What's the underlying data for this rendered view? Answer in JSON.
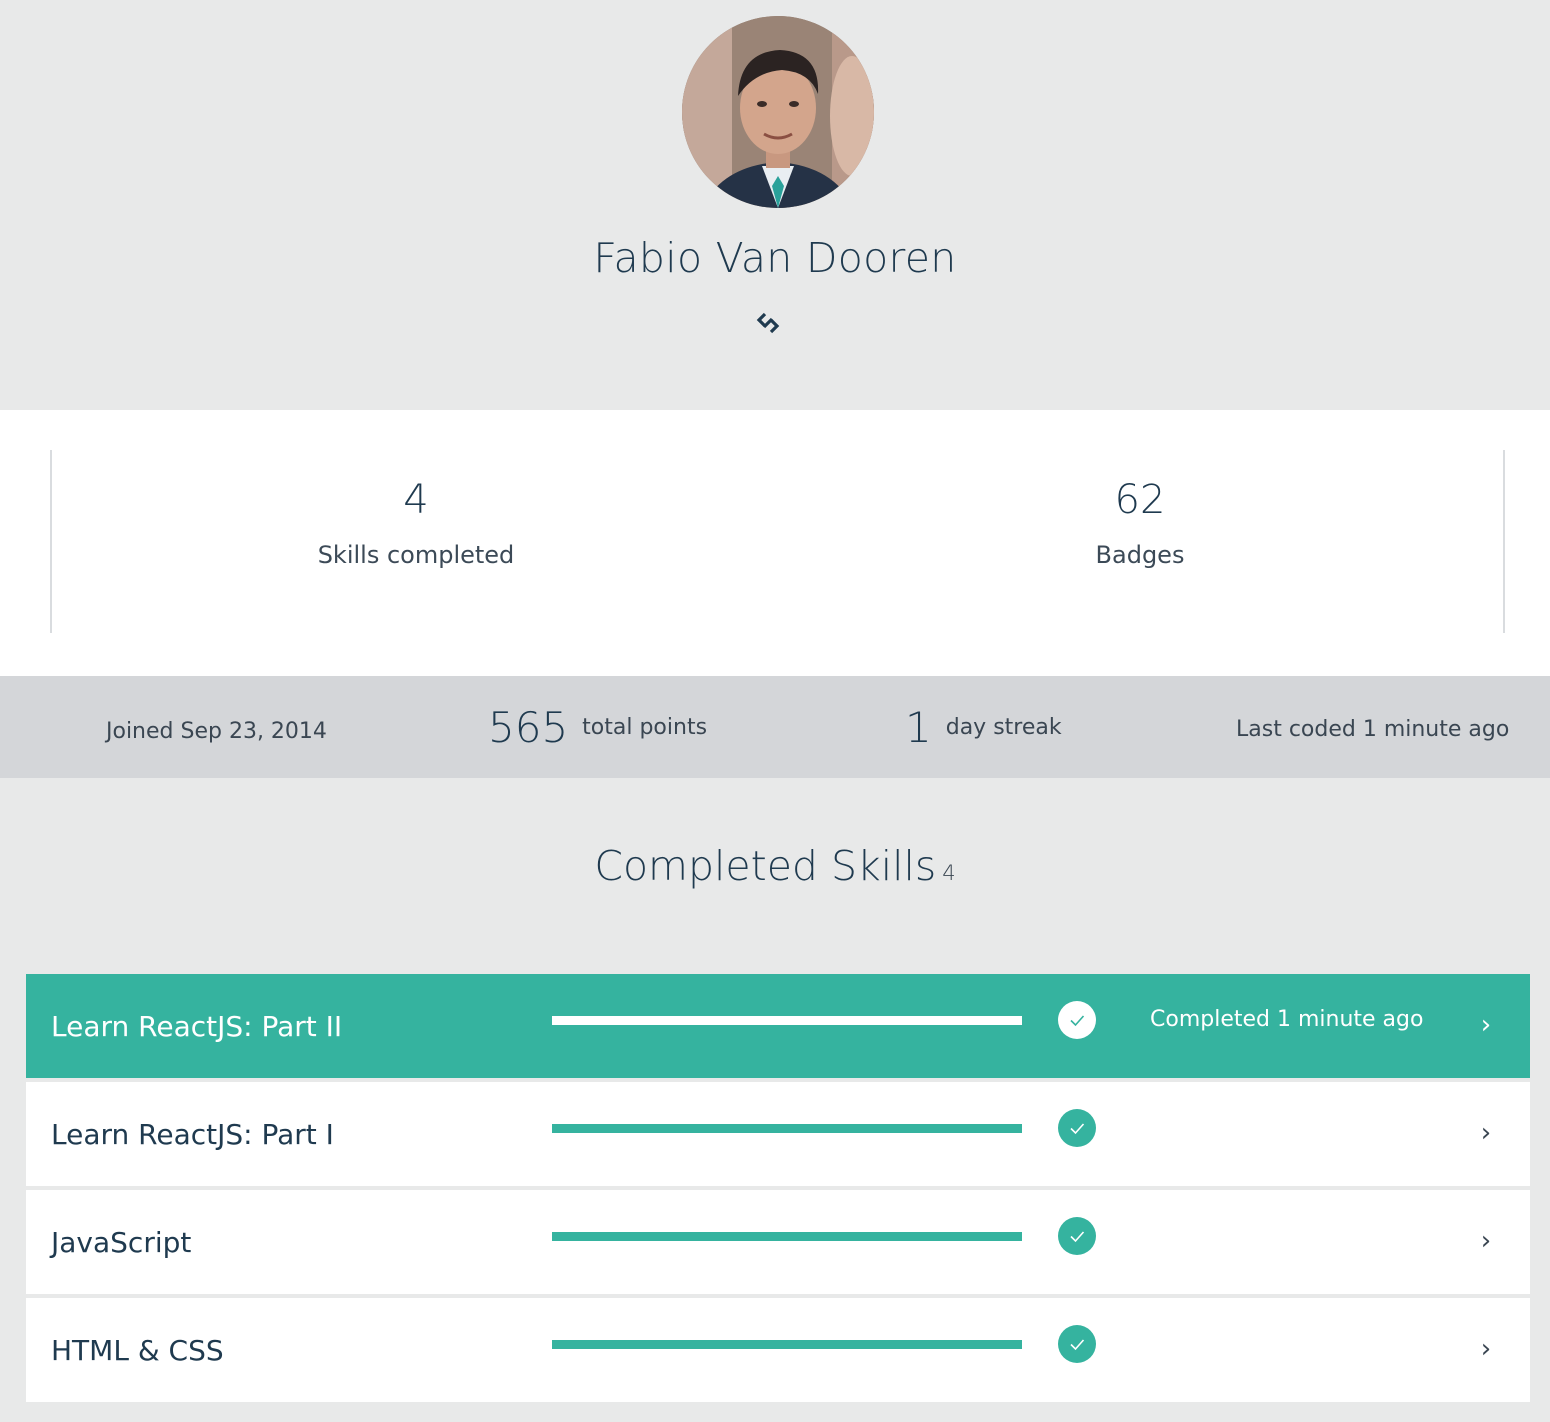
{
  "profile": {
    "name": "Fabio Van Dooren",
    "avatar_icon": "avatar-photo",
    "link_icon": "link-icon"
  },
  "stats": {
    "skills_value": "4",
    "skills_label": "Skills completed",
    "badges_value": "62",
    "badges_label": "Badges"
  },
  "meta": {
    "joined": "Joined Sep 23, 2014",
    "points_value": "565",
    "points_label": "total points",
    "streak_value": "1",
    "streak_label": "day streak",
    "last_coded": "Last coded 1 minute ago"
  },
  "completed_skills": {
    "title": "Completed Skills",
    "count": "4",
    "items": [
      {
        "name": "Learn ReactJS: Part II",
        "progress": 1.0,
        "status": "Completed 1 minute ago",
        "active": true
      },
      {
        "name": "Learn ReactJS: Part I",
        "progress": 1.0,
        "status": "",
        "active": false
      },
      {
        "name": "JavaScript",
        "progress": 1.0,
        "status": "",
        "active": false
      },
      {
        "name": "HTML & CSS",
        "progress": 1.0,
        "status": "",
        "active": false
      }
    ]
  },
  "colors": {
    "accent": "#35b39f",
    "text_dark": "#1f3a4f",
    "page_bg": "#e8e9e9",
    "meta_bg": "#d4d6d9"
  }
}
